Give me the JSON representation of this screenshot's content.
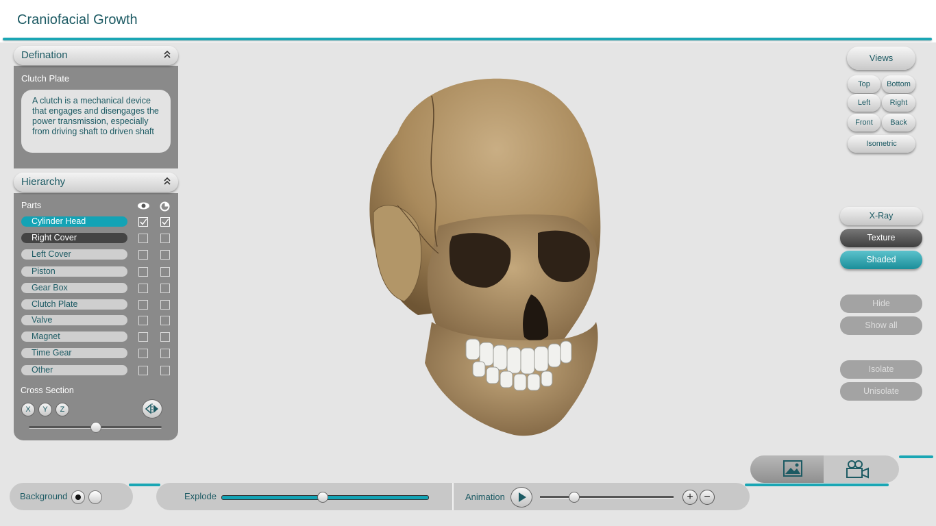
{
  "app": {
    "title": "Craniofacial Growth"
  },
  "definition": {
    "header": "Defination",
    "part_name": "Clutch Plate",
    "text": "A clutch is a mechanical device that engages and disengages the power transmission, especially from driving shaft to driven shaft"
  },
  "hierarchy": {
    "header": "Hierarchy",
    "parts_label": "Parts",
    "parts": [
      {
        "label": "Cylinder Head",
        "visible": true,
        "transparent": true,
        "state": "selected"
      },
      {
        "label": "Right Cover",
        "visible": false,
        "transparent": false,
        "state": "hover"
      },
      {
        "label": "Left Cover",
        "visible": false,
        "transparent": false,
        "state": "normal"
      },
      {
        "label": "Piston",
        "visible": false,
        "transparent": false,
        "state": "normal"
      },
      {
        "label": "Gear Box",
        "visible": false,
        "transparent": false,
        "state": "normal"
      },
      {
        "label": "Clutch Plate",
        "visible": false,
        "transparent": false,
        "state": "normal"
      },
      {
        "label": "Valve",
        "visible": false,
        "transparent": false,
        "state": "normal"
      },
      {
        "label": "Magnet",
        "visible": false,
        "transparent": false,
        "state": "normal"
      },
      {
        "label": "Time Gear",
        "visible": false,
        "transparent": false,
        "state": "normal"
      },
      {
        "label": "Other",
        "visible": false,
        "transparent": false,
        "state": "normal"
      }
    ],
    "cross_section_label": "Cross Section",
    "axes": [
      "X",
      "Y",
      "Z"
    ],
    "cross_section_value": 0.5
  },
  "views": {
    "label": "Views",
    "top": "Top",
    "bottom": "Bottom",
    "left": "Left",
    "right": "Right",
    "front": "Front",
    "back": "Back",
    "isometric": "Isometric"
  },
  "render_modes": {
    "xray": "X-Ray",
    "texture": "Texture",
    "shaded": "Shaded",
    "active": "Shaded"
  },
  "visibility": {
    "hide": "Hide",
    "show_all": "Show all",
    "isolate": "Isolate",
    "unisolate": "Unisolate"
  },
  "bottom": {
    "background_label": "Background",
    "explode_label": "Explode",
    "explode_value": 0.49,
    "animation_label": "Animation",
    "animation_value": 0.25,
    "zoom_in": "+",
    "zoom_out": "−"
  },
  "colors": {
    "accent": "#1aa6b4",
    "title": "#1c5a63",
    "panel": "#8a8a8a"
  },
  "icons": {
    "eye": "eye-icon",
    "transparency": "transparency-icon",
    "image": "image-icon",
    "video": "video-camera-icon"
  }
}
